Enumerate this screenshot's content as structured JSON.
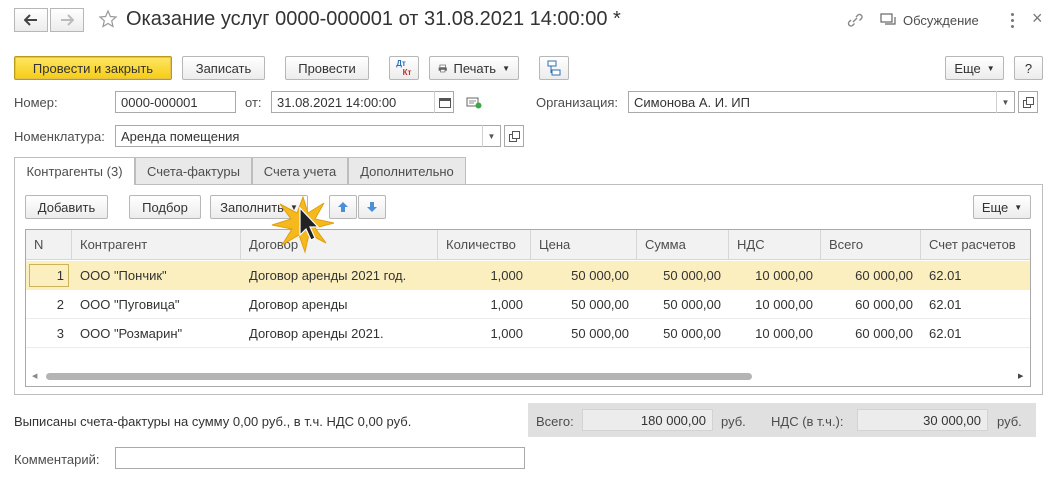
{
  "window": {
    "title": "Оказание услуг 0000-000001 от 31.08.2021 14:00:00 *",
    "discussion_label": "Обсуждение"
  },
  "toolbar": {
    "post_close": "Провести и закрыть",
    "save": "Записать",
    "post": "Провести",
    "print": "Печать",
    "more": "Еще",
    "help": "?",
    "dtkt_top": "Дт",
    "dtkt_bottom": "Кт"
  },
  "form": {
    "number_label": "Номер:",
    "number_value": "0000-000001",
    "date_label": "от:",
    "date_value": "31.08.2021 14:00:00",
    "org_label": "Организация:",
    "org_value": "Симонова А. И. ИП",
    "nomen_label": "Номенклатура:",
    "nomen_value": "Аренда помещения"
  },
  "tabs": [
    {
      "label": "Контрагенты (3)"
    },
    {
      "label": "Счета-фактуры"
    },
    {
      "label": "Счета учета"
    },
    {
      "label": "Дополнительно"
    }
  ],
  "tab_toolbar": {
    "add": "Добавить",
    "pick": "Подбор",
    "fill": "Заполнить",
    "more": "Еще"
  },
  "table": {
    "columns": [
      "N",
      "Контрагент",
      "Договор",
      "Количество",
      "Цена",
      "Сумма",
      "НДС",
      "Всего",
      "Счет расчетов"
    ],
    "rows": [
      {
        "n": "1",
        "contractor": "ООО \"Пончик\"",
        "contract": "Договор аренды 2021 год.",
        "qty": "1,000",
        "price": "50 000,00",
        "sum": "50 000,00",
        "vat": "10 000,00",
        "total": "60 000,00",
        "account": "62.01"
      },
      {
        "n": "2",
        "contractor": "ООО \"Пуговица\"",
        "contract": "Договор аренды",
        "qty": "1,000",
        "price": "50 000,00",
        "sum": "50 000,00",
        "vat": "10 000,00",
        "total": "60 000,00",
        "account": "62.01"
      },
      {
        "n": "3",
        "contractor": "ООО \"Розмарин\"",
        "contract": "Договор аренды 2021.",
        "qty": "1,000",
        "price": "50 000,00",
        "sum": "50 000,00",
        "vat": "10 000,00",
        "total": "60 000,00",
        "account": "62.01"
      }
    ]
  },
  "footer": {
    "invoices_text": "Выписаны счета-фактуры на сумму 0,00 руб., в т.ч. НДС 0,00 руб.",
    "total_label": "Всего:",
    "total_value": "180 000,00",
    "currency1": "руб.",
    "vat_label": "НДС (в т.ч.):",
    "vat_value": "30 000,00",
    "currency2": "руб.",
    "comment_label": "Комментарий:",
    "comment_value": ""
  },
  "colors": {
    "primary_button": "#f5cd13",
    "selected_row": "#fbeebf",
    "footer_panel": "#e0e0e0",
    "nav_arrow": "#4a8fd8"
  }
}
